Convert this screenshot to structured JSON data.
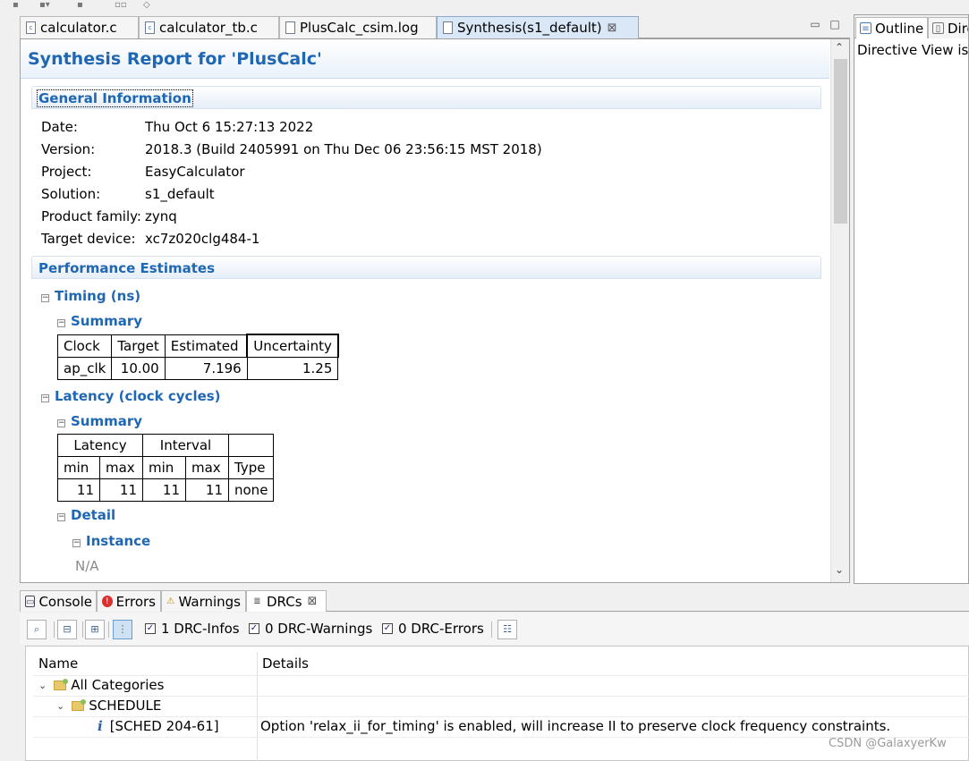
{
  "editor_tabs": [
    {
      "label": "calculator.c",
      "icon": "c-file-icon"
    },
    {
      "label": "calculator_tb.c",
      "icon": "c-file-icon"
    },
    {
      "label": "PlusCalc_csim.log",
      "icon": "log-file-icon"
    },
    {
      "label": "Synthesis(s1_default)",
      "icon": "report-icon",
      "active": true
    }
  ],
  "report": {
    "title": "Synthesis Report for 'PlusCalc'",
    "general": {
      "heading": "General Information",
      "rows": [
        {
          "key": "Date:",
          "value": "Thu Oct 6 15:27:13 2022"
        },
        {
          "key": "Version:",
          "value": "2018.3 (Build 2405991 on Thu Dec 06 23:56:15 MST 2018)"
        },
        {
          "key": "Project:",
          "value": "EasyCalculator"
        },
        {
          "key": "Solution:",
          "value": "s1_default"
        },
        {
          "key": "Product family:",
          "value": "zynq"
        },
        {
          "key": "Target device:",
          "value": "xc7z020clg484-1"
        }
      ]
    },
    "performance": {
      "heading": "Performance Estimates",
      "timing": {
        "heading": "Timing (ns)",
        "summary_heading": "Summary",
        "headers": [
          "Clock",
          "Target",
          "Estimated",
          "Uncertainty"
        ],
        "row": [
          "ap_clk",
          "10.00",
          "7.196",
          "1.25"
        ]
      },
      "latency": {
        "heading": "Latency (clock cycles)",
        "summary_heading": "Summary",
        "group_headers": [
          "Latency",
          "Interval"
        ],
        "headers": [
          "min",
          "max",
          "min",
          "max",
          "Type"
        ],
        "row": [
          "11",
          "11",
          "11",
          "11",
          "none"
        ],
        "detail_heading": "Detail",
        "instance_heading": "Instance",
        "instance_value": "N/A"
      }
    }
  },
  "right_pane": {
    "tabs": [
      "Outline",
      "Dire"
    ],
    "message": "Directive View is n"
  },
  "bottom_tabs": [
    {
      "label": "Console"
    },
    {
      "label": "Errors"
    },
    {
      "label": "Warnings"
    },
    {
      "label": "DRCs",
      "active": true
    }
  ],
  "drc_toolbar": {
    "infos": "1 DRC-Infos",
    "warnings": "0 DRC-Warnings",
    "errors": "0 DRC-Errors"
  },
  "drc_tree": {
    "col_name": "Name",
    "col_details": "Details",
    "root": "All Categories",
    "category": "SCHEDULE",
    "item": {
      "name": "[SCHED 204-61]",
      "details": "Option 'relax_ii_for_timing' is enabled, will increase II to preserve clock frequency constraints."
    }
  },
  "watermark": "CSDN @GalaxyerKw"
}
